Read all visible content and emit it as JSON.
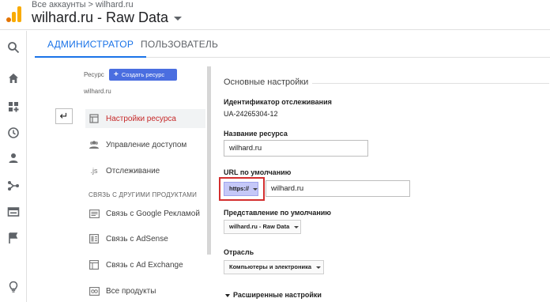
{
  "header": {
    "breadcrumb_root": "Все аккаунты",
    "breadcrumb_sep": ">",
    "breadcrumb_account": "wilhard.ru",
    "view_title": "wilhard.ru - Raw Data"
  },
  "tabs": [
    {
      "label": "АДМИНИСТРАТОР",
      "active": true
    },
    {
      "label": "ПОЛЬЗОВАТЕЛЬ",
      "active": false
    }
  ],
  "nav_icons": [
    "search-icon",
    "home-icon",
    "dashboard-icon",
    "clock-icon",
    "person-icon",
    "acquisition-icon",
    "behavior-icon",
    "flag-icon",
    "lightbulb-icon"
  ],
  "resource_column": {
    "label": "Ресурс",
    "create_button": "Создать ресурс",
    "resource_name": "wilhard.ru",
    "items": [
      {
        "label": "Настройки ресурса",
        "icon": "settings-page-icon",
        "glyph": "",
        "active": true
      },
      {
        "label": "Управление доступом",
        "icon": "users-icon",
        "glyph": "",
        "active": false
      },
      {
        "label": "Отслеживание",
        "icon": "js-icon",
        "glyph": ".js",
        "active": false
      }
    ],
    "section_title": "СВЯЗЬ С ДРУГИМИ ПРОДУКТАМИ",
    "linked": [
      {
        "label": "Связь с Google Рекламой",
        "icon": "ads-icon"
      },
      {
        "label": "Связь с AdSense",
        "icon": "adsense-icon"
      },
      {
        "label": "Связь с Ad Exchange",
        "icon": "adexchange-icon"
      },
      {
        "label": "Все продукты",
        "icon": "all-products-icon"
      }
    ]
  },
  "settings": {
    "section_title": "Основные настройки",
    "tracking_id_label": "Идентификатор отслеживания",
    "tracking_id_value": "UA-24265304-12",
    "name_label": "Название ресурса",
    "name_value": "wilhard.ru",
    "url_label": "URL по умолчанию",
    "protocol_value": "https://",
    "url_value": "wilhard.ru",
    "view_label": "Представление по умолчанию",
    "view_value": "wilhard.ru - Raw Data",
    "industry_label": "Отрасль",
    "industry_value": "Компьютеры и электроника",
    "advanced_label": "Расширенные настройки"
  },
  "colors": {
    "accent_blue": "#1a73e8",
    "active_item_red": "#c62828",
    "highlight_outline": "#d32f2f",
    "protocol_bg": "#c5c8f8"
  }
}
